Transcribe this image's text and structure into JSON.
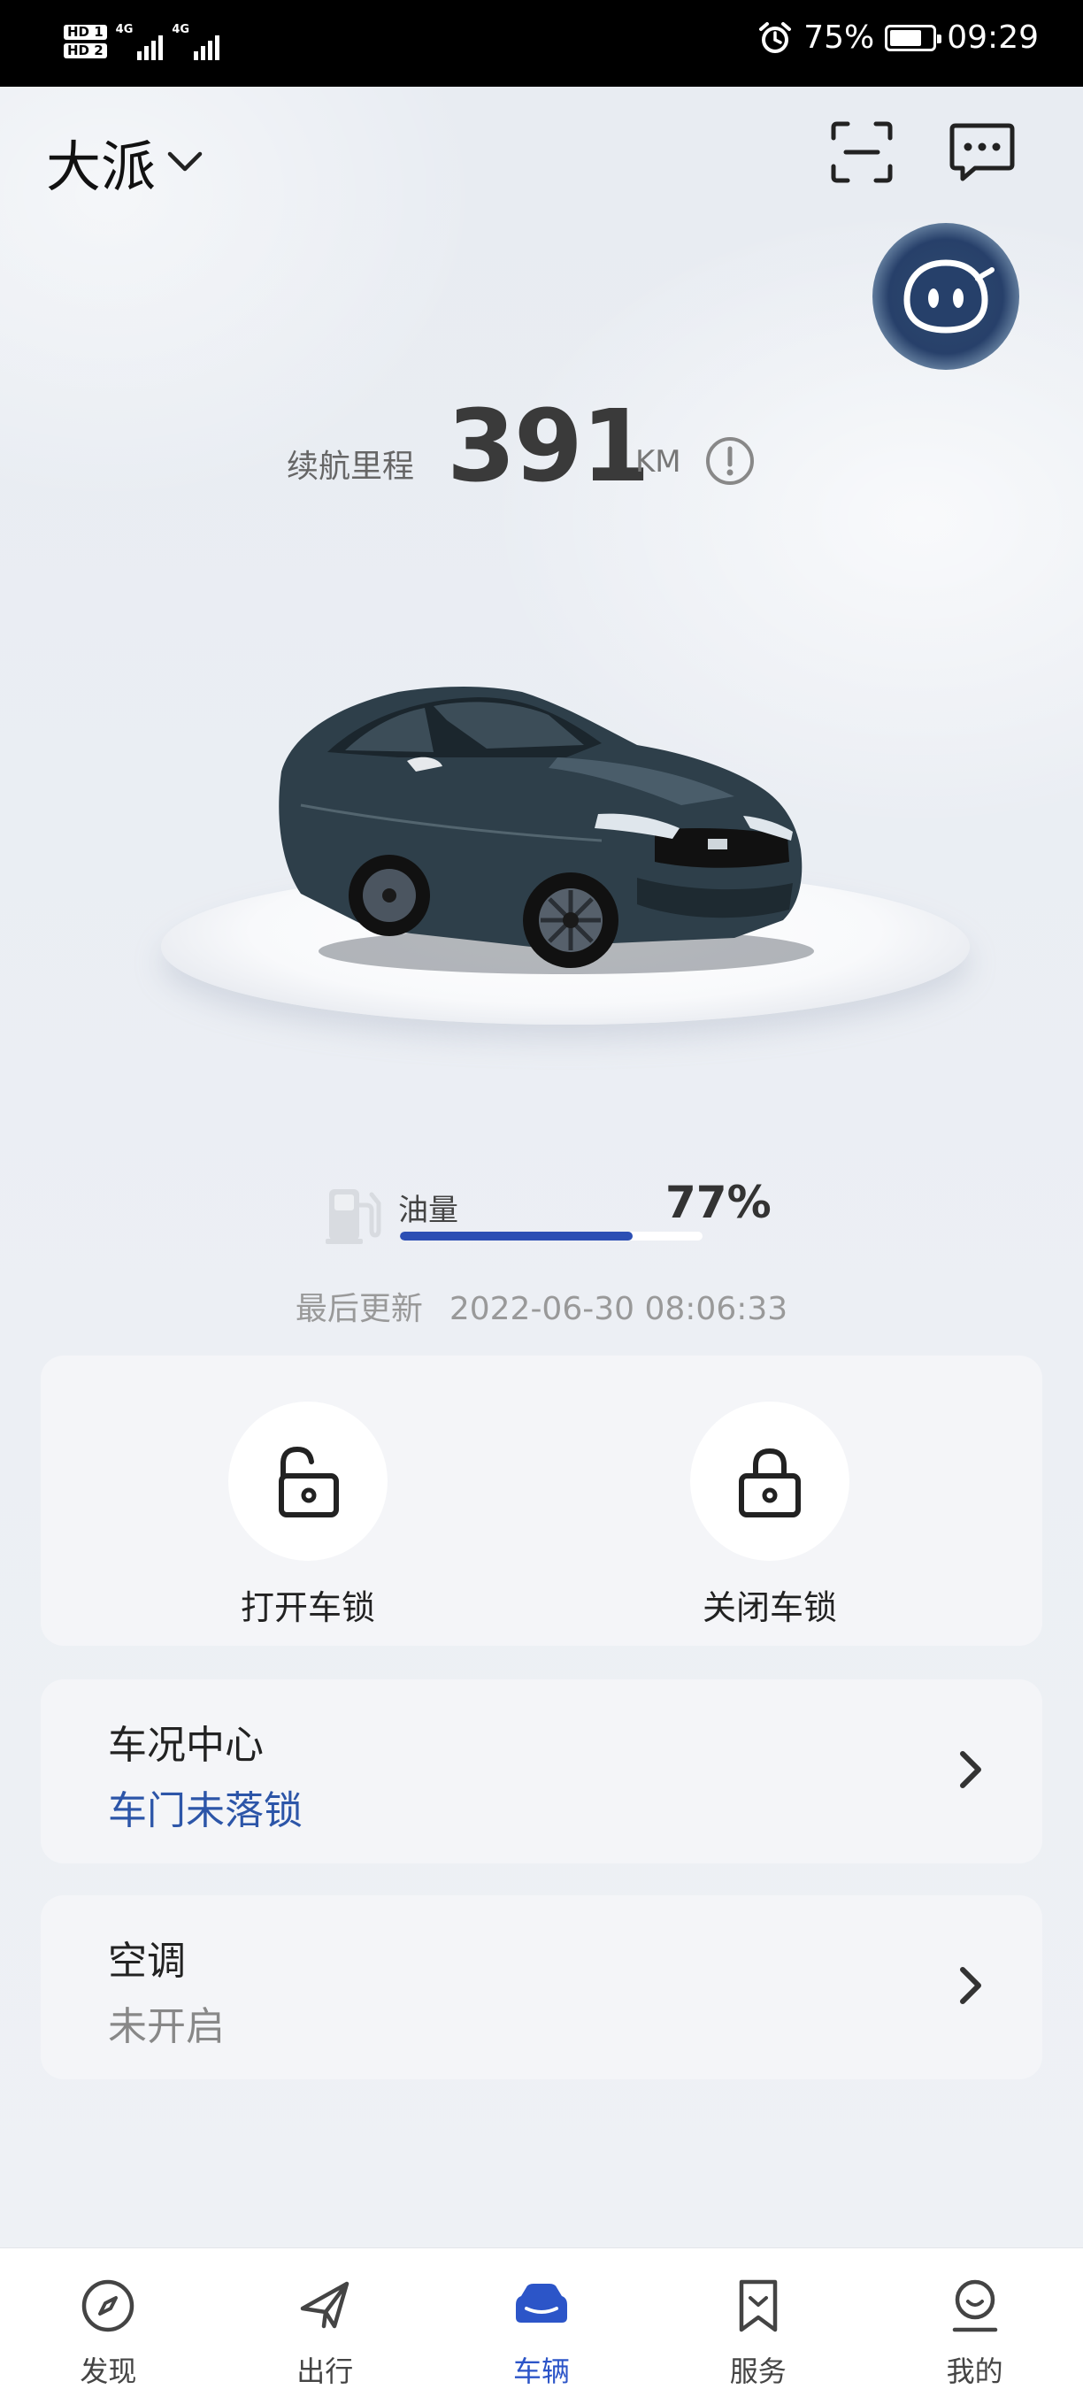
{
  "status_bar": {
    "sim1": "HD 1",
    "sim2": "HD 2",
    "net1": "4G",
    "net2": "4G",
    "battery_percent": "75%",
    "battery_level": 0.75,
    "time": "09:29"
  },
  "header": {
    "car_name": "大派",
    "icons": [
      "chevron-down-icon",
      "scan-icon",
      "message-icon",
      "assistant-robot-icon"
    ]
  },
  "range": {
    "label": "续航里程",
    "value": "391",
    "unit": "KM"
  },
  "fuel": {
    "label": "油量",
    "value_text": "77%",
    "level": 0.77,
    "bar_color": "#2c4fb4"
  },
  "last_updated": {
    "label": "最后更新",
    "timestamp": "2022-06-30 08:06:33"
  },
  "locks": {
    "unlock_label": "打开车锁",
    "lock_label": "关闭车锁"
  },
  "vehicle_status": {
    "title": "车况中心",
    "status": "车门未落锁",
    "status_color": "#2c55a8"
  },
  "climate": {
    "title": "空调",
    "status": "未开启"
  },
  "bottom_nav": {
    "active": "车辆",
    "active_color": "#2c55c8",
    "items": [
      {
        "label": "发现",
        "icon": "compass-icon"
      },
      {
        "label": "出行",
        "icon": "plane-icon"
      },
      {
        "label": "车辆",
        "icon": "car-icon"
      },
      {
        "label": "服务",
        "icon": "bookmark-icon"
      },
      {
        "label": "我的",
        "icon": "profile-icon"
      }
    ]
  }
}
